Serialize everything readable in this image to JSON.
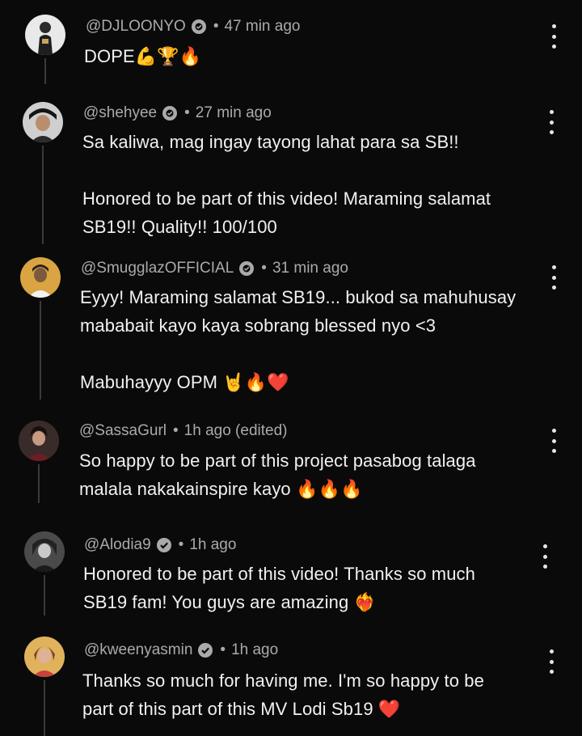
{
  "comments": [
    {
      "handle": "@DJLOONYO",
      "time": "47 min ago",
      "text": "DOPE💪🏆🔥",
      "badge": "verified-creator-icon"
    },
    {
      "handle": "@shehyee",
      "time": "27 min ago",
      "text": "Sa kaliwa, mag ingay tayong lahat para sa SB!!\n\nHonored to be part of this video! Maraming salamat\nSB19!! Quality!! 100/100",
      "badge": "verified-creator-icon"
    },
    {
      "handle": "@SmugglazOFFICIAL",
      "time": "31 min ago",
      "text": "Eyyy! Maraming salamat SB19... bukod sa mahuhusay\nmababait kayo kaya sobrang blessed nyo <3\n\nMabuhayyy OPM 🤘🔥❤️",
      "badge": "verified-creator-icon"
    },
    {
      "handle": "@SassaGurl",
      "time": "1h ago (edited)",
      "text": "So happy to be part of this project pasabog talaga\nmalala nakakainspire kayo 🔥🔥🔥",
      "badge": ""
    },
    {
      "handle": "@Alodia9",
      "time": "1h ago",
      "text": "Honored to be part of this video! Thanks so much\nSB19 fam! You guys are amazing ❤️‍🔥",
      "badge": "verified-check-icon"
    },
    {
      "handle": "@kweenyasmin",
      "time": "1h ago",
      "text": "Thanks so much for having me. I'm so happy to be\npart of this part of this MV Lodi Sb19 ❤️",
      "badge": "verified-check-icon"
    }
  ],
  "colors": {
    "background": "#0a0a0a",
    "text": "#f1f1f1",
    "meta": "#aaaaaa",
    "thread_line": "#3a3a3a"
  }
}
